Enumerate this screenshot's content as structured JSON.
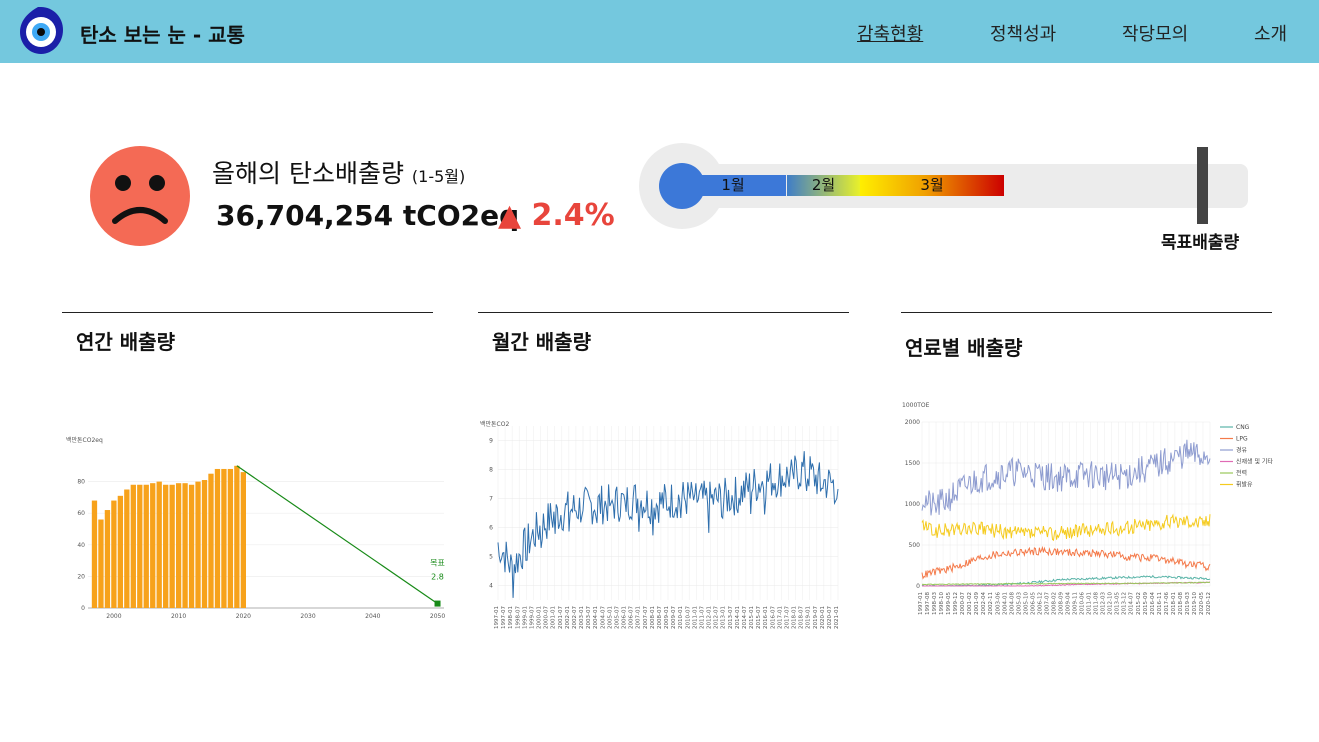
{
  "header": {
    "app_title": "탄소 보는 눈 - 교통",
    "nav": [
      {
        "label": "감축현황",
        "active": true
      },
      {
        "label": "정책성과",
        "active": false
      },
      {
        "label": "작당모의",
        "active": false
      },
      {
        "label": "소개",
        "active": false
      }
    ],
    "logo_icon": "evil-eye-icon"
  },
  "summary": {
    "label": "올해의 탄소배출량",
    "period": "(1-5월)",
    "value": "36,704,254 tCO2eq",
    "change": "▲ 2.4%",
    "mood_icon": "sad-face-icon",
    "colors": {
      "face": "#f46a55",
      "change": "#e8453c"
    }
  },
  "progress": {
    "months": [
      "1월",
      "2월",
      "3월"
    ],
    "target_label": "목표배출량",
    "fraction_of_target": 0.58,
    "colors": {
      "month1": "#3c78d8",
      "track": "#ececec",
      "target": "#444444"
    }
  },
  "sections": {
    "annual_title": "연간 배출량",
    "monthly_title": "월간 배출량",
    "fuel_title": "연료별 배출량"
  },
  "chart_data": [
    {
      "type": "bar",
      "ylabel": "백만톤CO2eq",
      "categories": [
        1997,
        1998,
        1999,
        2000,
        2001,
        2002,
        2003,
        2004,
        2005,
        2006,
        2007,
        2008,
        2009,
        2010,
        2011,
        2012,
        2013,
        2014,
        2015,
        2016,
        2017,
        2018,
        2019,
        2020
      ],
      "values": [
        68,
        56,
        62,
        68,
        71,
        75,
        78,
        78,
        78,
        79,
        80,
        78,
        78,
        79,
        79,
        78,
        80,
        81,
        85,
        88,
        88,
        88,
        90,
        86
      ],
      "target": {
        "label": "목표",
        "value_label": "2.8",
        "x": 2050,
        "y": 2.8
      },
      "ylim": [
        0,
        100
      ],
      "xlim": [
        1996,
        2051
      ],
      "xticks": [
        2000,
        2010,
        2020,
        2030,
        2040,
        2050
      ],
      "yticks": [
        0,
        20,
        40,
        60,
        80
      ],
      "colors": {
        "bar": "#f7a21b",
        "trend": "#178a17"
      }
    },
    {
      "type": "line",
      "ylabel": "백만톤CO2",
      "yticks": [
        4,
        5,
        6,
        7,
        8,
        9
      ],
      "ylim": [
        3.5,
        9.5
      ],
      "x_start": "1997-01",
      "x_end": "2021-05",
      "x_tick_labels": [
        "1997-01",
        "1997-07",
        "1998-01",
        "1998-07",
        "1999-01",
        "1999-07",
        "2000-01",
        "2000-07",
        "2001-01",
        "2001-07",
        "2002-01",
        "2002-07",
        "2003-01",
        "2003-07",
        "2004-01",
        "2004-07",
        "2005-01",
        "2005-07",
        "2006-01",
        "2006-07",
        "2007-01",
        "2007-07",
        "2008-01",
        "2008-07",
        "2009-01",
        "2009-07",
        "2010-01",
        "2010-07",
        "2011-01",
        "2011-07",
        "2012-01",
        "2012-07",
        "2013-01",
        "2013-07",
        "2014-01",
        "2014-07",
        "2015-01",
        "2015-07",
        "2016-01",
        "2016-07",
        "2017-01",
        "2017-07",
        "2018-01",
        "2018-07",
        "2019-01",
        "2019-07",
        "2020-01",
        "2020-07",
        "2021-01"
      ],
      "series": [
        {
          "annual_means": [
            5.5,
            4.6,
            5.4,
            6.0,
            6.4,
            6.6,
            6.7,
            6.8,
            6.8,
            6.9,
            7.0,
            6.8,
            6.9,
            7.0,
            7.0,
            6.9,
            7.0,
            7.1,
            7.4,
            7.6,
            7.7,
            7.8,
            8.0,
            7.6,
            7.5
          ],
          "color": "#2f6fad"
        }
      ]
    },
    {
      "type": "line",
      "ylabel": "1000TOE",
      "yticks": [
        0,
        500,
        1000,
        1500,
        2000
      ],
      "ylim": [
        0,
        2000
      ],
      "x_tick_labels": [
        "1997-01",
        "1997-08",
        "1998-03",
        "1998-10",
        "1999-05",
        "1999-12",
        "2000-07",
        "2001-02",
        "2001-09",
        "2002-04",
        "2002-11",
        "2003-06",
        "2004-01",
        "2004-08",
        "2005-03",
        "2005-10",
        "2006-05",
        "2006-12",
        "2007-07",
        "2008-02",
        "2008-09",
        "2009-04",
        "2009-11",
        "2010-06",
        "2011-01",
        "2011-08",
        "2012-03",
        "2012-10",
        "2013-05",
        "2013-12",
        "2014-07",
        "2015-02",
        "2015-09",
        "2016-04",
        "2016-11",
        "2017-06",
        "2018-01",
        "2018-08",
        "2019-03",
        "2019-10",
        "2020-05",
        "2020-12"
      ],
      "legend_position": "right",
      "series": [
        {
          "name": "CNG",
          "color": "#5ab4a8",
          "annual_means": [
            0,
            0,
            0,
            0,
            2,
            8,
            15,
            22,
            30,
            40,
            55,
            70,
            80,
            85,
            90,
            95,
            100,
            105,
            110,
            115,
            110,
            105,
            100,
            95,
            90
          ]
        },
        {
          "name": "LPG",
          "color": "#f47a4a",
          "annual_means": [
            130,
            170,
            200,
            240,
            300,
            350,
            380,
            400,
            410,
            420,
            430,
            420,
            410,
            405,
            400,
            395,
            380,
            360,
            350,
            340,
            320,
            300,
            270,
            250,
            230
          ]
        },
        {
          "name": "경유",
          "color": "#8e9cd0",
          "annual_means": [
            1080,
            950,
            1050,
            1150,
            1250,
            1320,
            1350,
            1380,
            1400,
            1380,
            1350,
            1320,
            1330,
            1350,
            1360,
            1340,
            1330,
            1350,
            1400,
            1450,
            1500,
            1560,
            1620,
            1580,
            1600
          ]
        },
        {
          "name": "신재생 및 기타",
          "color": "#e06bb4",
          "annual_means": [
            0,
            0,
            0,
            0,
            0,
            0,
            0,
            0,
            0,
            0,
            5,
            10,
            15,
            20,
            20,
            25,
            25,
            30,
            30,
            35,
            35,
            40,
            40,
            40,
            45
          ]
        },
        {
          "name": "전력",
          "color": "#98c85a",
          "annual_means": [
            20,
            20,
            22,
            22,
            24,
            25,
            25,
            26,
            27,
            28,
            28,
            30,
            30,
            30,
            32,
            32,
            32,
            33,
            34,
            35,
            36,
            38,
            40,
            42,
            45
          ]
        },
        {
          "name": "휘발유",
          "color": "#f5cb1f",
          "annual_means": [
            750,
            660,
            680,
            690,
            700,
            690,
            680,
            650,
            640,
            640,
            650,
            640,
            660,
            670,
            680,
            690,
            700,
            710,
            740,
            760,
            780,
            790,
            810,
            780,
            800
          ]
        }
      ]
    }
  ]
}
